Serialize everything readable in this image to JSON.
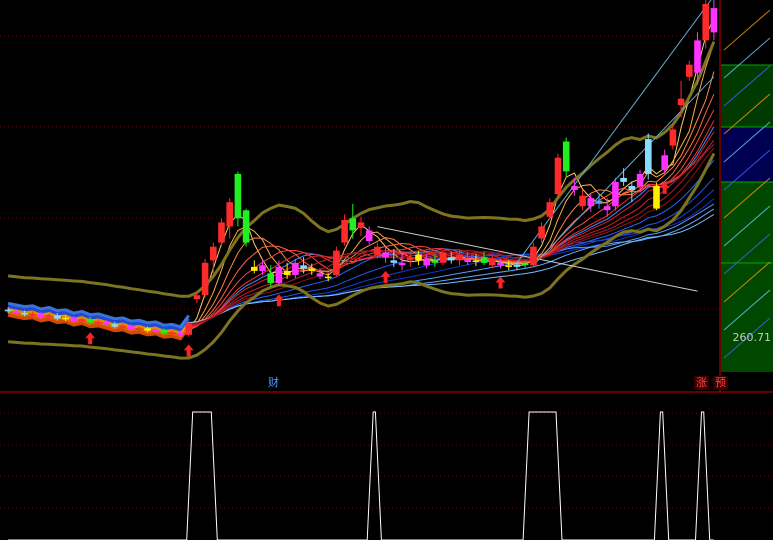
{
  "colors": {
    "background": "#000000",
    "grid": "#7a0000",
    "up": "#ff2a2a",
    "down": "#22ee22",
    "magenta": "#ff33ff",
    "yellow": "#ffee00",
    "cyan": "#88ddff",
    "olive": "#7d7420",
    "ribbon_warm": "#ff5500",
    "ribbon_cool": "#2255ff",
    "label_red": "#ff4444",
    "label_blue": "#5599ff",
    "arrow": "#ff2222"
  },
  "labels": {
    "price": "260.71",
    "event_finance": "财",
    "event_limit_up": "涨",
    "event_forecast": "预"
  },
  "chart_data": [
    {
      "type": "candlestick",
      "title": "",
      "xlabel": "",
      "ylabel": "",
      "ylim": [
        240,
        700
      ],
      "grid": true,
      "marker_price": 260.71,
      "candles": [
        {
          "o": 317,
          "h": 320,
          "l": 313,
          "c": 315,
          "color": "cyan"
        },
        {
          "o": 315,
          "h": 318,
          "l": 311,
          "c": 313,
          "color": "magenta"
        },
        {
          "o": 313,
          "h": 316,
          "l": 309,
          "c": 311,
          "color": "cyan"
        },
        {
          "o": 311,
          "h": 315,
          "l": 308,
          "c": 312,
          "color": "up"
        },
        {
          "o": 312,
          "h": 314,
          "l": 306,
          "c": 308,
          "color": "magenta"
        },
        {
          "o": 308,
          "h": 312,
          "l": 305,
          "c": 310,
          "color": "up"
        },
        {
          "o": 310,
          "h": 313,
          "l": 304,
          "c": 306,
          "color": "cyan"
        },
        {
          "o": 306,
          "h": 310,
          "l": 303,
          "c": 307,
          "color": "yellow"
        },
        {
          "o": 307,
          "h": 309,
          "l": 301,
          "c": 303,
          "color": "magenta"
        },
        {
          "o": 303,
          "h": 307,
          "l": 300,
          "c": 305,
          "color": "up"
        },
        {
          "o": 305,
          "h": 308,
          "l": 299,
          "c": 301,
          "color": "down"
        },
        {
          "o": 301,
          "h": 305,
          "l": 298,
          "c": 302,
          "color": "up"
        },
        {
          "o": 302,
          "h": 304,
          "l": 297,
          "c": 299,
          "color": "magenta"
        },
        {
          "o": 299,
          "h": 302,
          "l": 294,
          "c": 296,
          "color": "cyan"
        },
        {
          "o": 296,
          "h": 300,
          "l": 293,
          "c": 297,
          "color": "up"
        },
        {
          "o": 297,
          "h": 299,
          "l": 291,
          "c": 293,
          "color": "magenta"
        },
        {
          "o": 293,
          "h": 296,
          "l": 290,
          "c": 294,
          "color": "up"
        },
        {
          "o": 294,
          "h": 296,
          "l": 289,
          "c": 291,
          "color": "yellow"
        },
        {
          "o": 291,
          "h": 294,
          "l": 288,
          "c": 292,
          "color": "magenta"
        },
        {
          "o": 292,
          "h": 294,
          "l": 286,
          "c": 288,
          "color": "down"
        },
        {
          "o": 288,
          "h": 292,
          "l": 285,
          "c": 289,
          "color": "up"
        },
        {
          "o": 289,
          "h": 291,
          "l": 284,
          "c": 286,
          "color": "magenta"
        },
        {
          "o": 286,
          "h": 302,
          "l": 284,
          "c": 300,
          "color": "up"
        },
        {
          "o": 330,
          "h": 340,
          "l": 325,
          "c": 335,
          "color": "up"
        },
        {
          "o": 335,
          "h": 380,
          "l": 332,
          "c": 375,
          "color": "up"
        },
        {
          "o": 378,
          "h": 400,
          "l": 362,
          "c": 395,
          "color": "up"
        },
        {
          "o": 400,
          "h": 430,
          "l": 395,
          "c": 425,
          "color": "up"
        },
        {
          "o": 420,
          "h": 455,
          "l": 405,
          "c": 450,
          "color": "up"
        },
        {
          "o": 485,
          "h": 488,
          "l": 420,
          "c": 430,
          "color": "down"
        },
        {
          "o": 440,
          "h": 442,
          "l": 395,
          "c": 400,
          "color": "down"
        },
        {
          "o": 370,
          "h": 378,
          "l": 362,
          "c": 365,
          "color": "yellow"
        },
        {
          "o": 365,
          "h": 380,
          "l": 360,
          "c": 372,
          "color": "magenta"
        },
        {
          "o": 362,
          "h": 372,
          "l": 345,
          "c": 350,
          "color": "down"
        },
        {
          "o": 350,
          "h": 378,
          "l": 346,
          "c": 370,
          "color": "magenta"
        },
        {
          "o": 365,
          "h": 375,
          "l": 355,
          "c": 360,
          "color": "yellow"
        },
        {
          "o": 360,
          "h": 380,
          "l": 356,
          "c": 375,
          "color": "magenta"
        },
        {
          "o": 372,
          "h": 382,
          "l": 362,
          "c": 368,
          "color": "cyan"
        },
        {
          "o": 368,
          "h": 374,
          "l": 360,
          "c": 365,
          "color": "yellow"
        },
        {
          "o": 362,
          "h": 368,
          "l": 355,
          "c": 358,
          "color": "magenta"
        },
        {
          "o": 358,
          "h": 362,
          "l": 352,
          "c": 356,
          "color": "yellow"
        },
        {
          "o": 360,
          "h": 395,
          "l": 358,
          "c": 390,
          "color": "up"
        },
        {
          "o": 400,
          "h": 435,
          "l": 396,
          "c": 428,
          "color": "up"
        },
        {
          "o": 430,
          "h": 448,
          "l": 405,
          "c": 415,
          "color": "down"
        },
        {
          "o": 418,
          "h": 432,
          "l": 408,
          "c": 425,
          "color": "up"
        },
        {
          "o": 415,
          "h": 420,
          "l": 398,
          "c": 402,
          "color": "magenta"
        },
        {
          "o": 385,
          "h": 400,
          "l": 380,
          "c": 395,
          "color": "up"
        },
        {
          "o": 382,
          "h": 395,
          "l": 375,
          "c": 388,
          "color": "magenta"
        },
        {
          "o": 378,
          "h": 392,
          "l": 370,
          "c": 375,
          "color": "cyan"
        },
        {
          "o": 375,
          "h": 388,
          "l": 366,
          "c": 372,
          "color": "magenta"
        },
        {
          "o": 378,
          "h": 386,
          "l": 370,
          "c": 382,
          "color": "up"
        },
        {
          "o": 385,
          "h": 390,
          "l": 372,
          "c": 378,
          "color": "yellow"
        },
        {
          "o": 372,
          "h": 386,
          "l": 368,
          "c": 380,
          "color": "magenta"
        },
        {
          "o": 378,
          "h": 386,
          "l": 370,
          "c": 375,
          "color": "down"
        },
        {
          "o": 375,
          "h": 390,
          "l": 372,
          "c": 388,
          "color": "up"
        },
        {
          "o": 382,
          "h": 388,
          "l": 374,
          "c": 378,
          "color": "cyan"
        },
        {
          "o": 378,
          "h": 392,
          "l": 372,
          "c": 385,
          "color": "up"
        },
        {
          "o": 380,
          "h": 388,
          "l": 372,
          "c": 376,
          "color": "magenta"
        },
        {
          "o": 376,
          "h": 386,
          "l": 371,
          "c": 378,
          "color": "yellow"
        },
        {
          "o": 382,
          "h": 388,
          "l": 372,
          "c": 375,
          "color": "down"
        },
        {
          "o": 372,
          "h": 385,
          "l": 368,
          "c": 380,
          "color": "up"
        },
        {
          "o": 375,
          "h": 380,
          "l": 368,
          "c": 372,
          "color": "magenta"
        },
        {
          "o": 372,
          "h": 378,
          "l": 366,
          "c": 370,
          "color": "yellow"
        },
        {
          "o": 370,
          "h": 376,
          "l": 366,
          "c": 373,
          "color": "cyan"
        },
        {
          "o": 372,
          "h": 378,
          "l": 368,
          "c": 374,
          "color": "down"
        },
        {
          "o": 372,
          "h": 400,
          "l": 370,
          "c": 395,
          "color": "up"
        },
        {
          "o": 405,
          "h": 425,
          "l": 400,
          "c": 420,
          "color": "up"
        },
        {
          "o": 432,
          "h": 455,
          "l": 430,
          "c": 450,
          "color": "up"
        },
        {
          "o": 460,
          "h": 510,
          "l": 455,
          "c": 505,
          "color": "up"
        },
        {
          "o": 525,
          "h": 530,
          "l": 482,
          "c": 488,
          "color": "down"
        },
        {
          "o": 470,
          "h": 480,
          "l": 458,
          "c": 465,
          "color": "magenta"
        },
        {
          "o": 458,
          "h": 465,
          "l": 440,
          "c": 445,
          "color": "up"
        },
        {
          "o": 445,
          "h": 460,
          "l": 438,
          "c": 455,
          "color": "magenta"
        },
        {
          "o": 452,
          "h": 460,
          "l": 442,
          "c": 448,
          "color": "blue"
        },
        {
          "o": 440,
          "h": 455,
          "l": 432,
          "c": 445,
          "color": "magenta"
        },
        {
          "o": 445,
          "h": 480,
          "l": 440,
          "c": 475,
          "color": "magenta"
        },
        {
          "o": 475,
          "h": 492,
          "l": 470,
          "c": 480,
          "color": "cyan"
        },
        {
          "o": 465,
          "h": 475,
          "l": 450,
          "c": 470,
          "color": "cyan"
        },
        {
          "o": 470,
          "h": 490,
          "l": 462,
          "c": 485,
          "color": "magenta"
        },
        {
          "o": 485,
          "h": 535,
          "l": 478,
          "c": 528,
          "color": "cyan"
        },
        {
          "o": 470,
          "h": 474,
          "l": 440,
          "c": 442,
          "color": "yellow"
        },
        {
          "o": 490,
          "h": 515,
          "l": 485,
          "c": 508,
          "color": "magenta"
        },
        {
          "o": 520,
          "h": 545,
          "l": 515,
          "c": 540,
          "color": "up"
        },
        {
          "o": 570,
          "h": 600,
          "l": 555,
          "c": 578,
          "color": "up"
        },
        {
          "o": 605,
          "h": 625,
          "l": 600,
          "c": 620,
          "color": "up"
        },
        {
          "o": 610,
          "h": 660,
          "l": 595,
          "c": 650,
          "color": "magenta"
        },
        {
          "o": 650,
          "h": 700,
          "l": 640,
          "c": 695,
          "color": "up"
        },
        {
          "o": 660,
          "h": 700,
          "l": 650,
          "c": 690,
          "color": "magenta"
        }
      ],
      "signal_arrows_at": [
        10,
        22,
        33,
        46,
        60,
        80
      ],
      "overlays": [
        "warm-ma-fan",
        "cool-ma-fan",
        "olive-band",
        "trend-lines",
        "ribbon"
      ]
    },
    {
      "type": "line",
      "title": "",
      "xlabel": "",
      "ylabel": "",
      "ylim": [
        0,
        1
      ],
      "grid": true,
      "signal_windows": [
        {
          "start": 22,
          "end": 25
        },
        {
          "start": 44,
          "end": 45
        },
        {
          "start": 63,
          "end": 67
        },
        {
          "start": 79,
          "end": 80
        },
        {
          "start": 84,
          "end": 85
        }
      ]
    }
  ]
}
